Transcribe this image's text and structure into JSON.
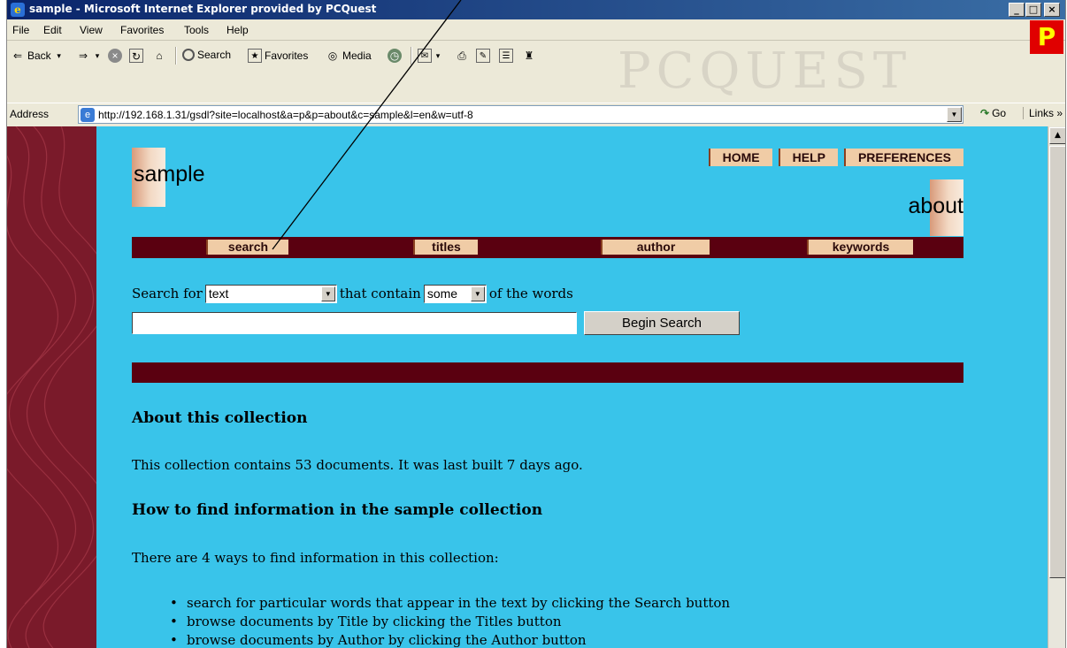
{
  "window": {
    "title": "sample - Microsoft Internet Explorer provided by PCQuest",
    "controls": {
      "minimize": "_",
      "maximize": "□",
      "close": "×"
    }
  },
  "menubar": {
    "items": [
      "File",
      "Edit",
      "View",
      "Favorites",
      "Tools",
      "Help"
    ],
    "brand_logo": "P",
    "watermark": "PCQUEST"
  },
  "toolbar": {
    "back": "Back",
    "search": "Search",
    "favorites": "Favorites",
    "media": "Media"
  },
  "addressbar": {
    "label": "Address",
    "url": "http://192.168.1.31/gsdl?site=localhost&a=p&p=about&c=sample&l=en&w=utf-8",
    "go": "Go",
    "links": "Links"
  },
  "page": {
    "collection_name": "sample",
    "page_heading": "about",
    "top_nav": [
      "HOME",
      "HELP",
      "PREFERENCES"
    ],
    "nav": [
      "search",
      "titles",
      "author",
      "keywords"
    ],
    "search_form": {
      "search_for_label": "Search for",
      "field_value": "text",
      "that_contain_label": "that contain",
      "match_value": "some",
      "of_words_label": "of the words",
      "query_value": "",
      "begin_search": "Begin Search"
    },
    "about_heading": "About this collection",
    "about_text": "This collection contains 53 documents. It was last built 7 days ago.",
    "howto_heading": "How to find information in the sample collection",
    "howto_intro": "There are 4 ways to find information in this collection:",
    "ways": [
      "search for particular words that appear in the text by clicking the Search button",
      "browse documents by Title by clicking the Titles button",
      "browse documents by Author by clicking the Author button"
    ]
  },
  "colors": {
    "page_bg": "#39c4ea",
    "nav_bar": "#5a0010",
    "nav_button": "#f0cca6",
    "side_band": "#7a1a2a"
  }
}
